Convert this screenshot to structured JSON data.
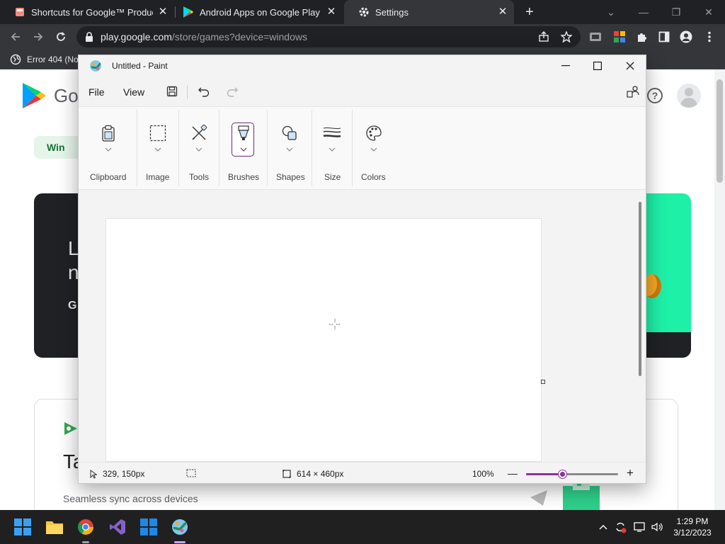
{
  "browser": {
    "tabs": [
      {
        "title": "Shortcuts for Google™ Products",
        "active": false
      },
      {
        "title": "Android Apps on Google Play",
        "active": false
      },
      {
        "title": "Settings",
        "active": true
      }
    ],
    "address": {
      "host": "play.google.com",
      "path": "/store/games?device=windows"
    },
    "bookmark": "Error 404 (No"
  },
  "play_page": {
    "logo_text": "Go",
    "chip": "Win",
    "hero_line1": "L",
    "hero_line2": "n",
    "hero_line3": "G",
    "card_title": "Ta",
    "card_subtitle": "Seamless sync across devices"
  },
  "paint": {
    "title": "Untitled - Paint",
    "menu": {
      "file": "File",
      "view": "View"
    },
    "ribbon": [
      {
        "label": "Clipboard",
        "icon": "clipboard-icon"
      },
      {
        "label": "Image",
        "icon": "select-icon"
      },
      {
        "label": "Tools",
        "icon": "tools-icon"
      },
      {
        "label": "Brushes",
        "icon": "brush-icon"
      },
      {
        "label": "Shapes",
        "icon": "shapes-icon"
      },
      {
        "label": "Size",
        "icon": "size-icon"
      },
      {
        "label": "Colors",
        "icon": "palette-icon"
      }
    ],
    "status": {
      "cursor_pos": "329, 150px",
      "canvas_size": "614 × 460px",
      "zoom": "100%",
      "zoom_fraction": 0.4
    },
    "accent": "#8e2f9c"
  },
  "taskbar": {
    "apps": [
      "windows-start-icon",
      "file-explorer-icon",
      "chrome-icon",
      "visual-studio-icon",
      "microsoft-store-icon",
      "paint-icon"
    ],
    "time": "1:29 PM",
    "date": "3/12/2023"
  }
}
